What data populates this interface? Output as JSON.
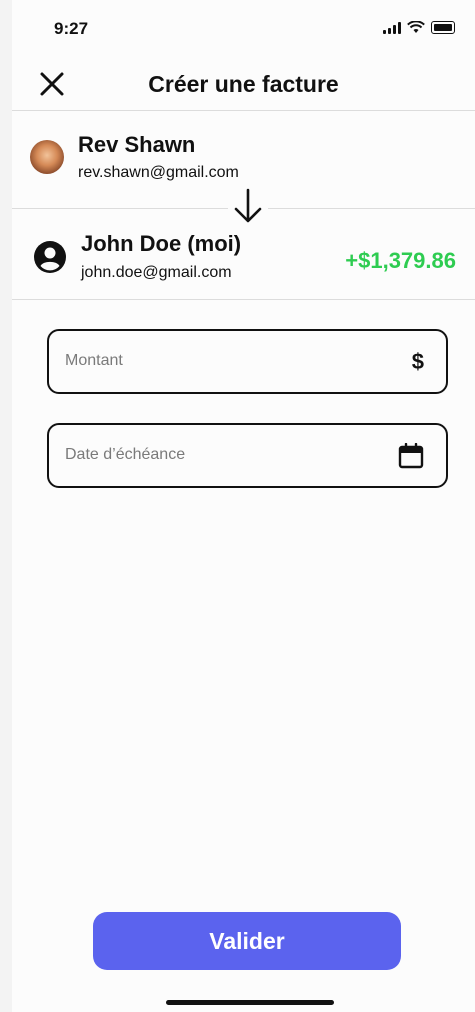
{
  "status_bar": {
    "time": "9:27"
  },
  "header": {
    "title": "Créer une facture",
    "close_icon": "close-icon"
  },
  "sender": {
    "name": "Rev Shawn",
    "email": "rev.shawn@gmail.com"
  },
  "recipient": {
    "name": "John Doe (moi)",
    "email": "john.doe@gmail.com",
    "amount": "+$1,379.86"
  },
  "form": {
    "amount_placeholder": "Montant",
    "amount_icon_glyph": "$",
    "due_date_placeholder": "Date d’échéance"
  },
  "actions": {
    "validate_label": "Valider"
  },
  "colors": {
    "accent": "#5b63ee",
    "positive": "#2ecc51"
  }
}
